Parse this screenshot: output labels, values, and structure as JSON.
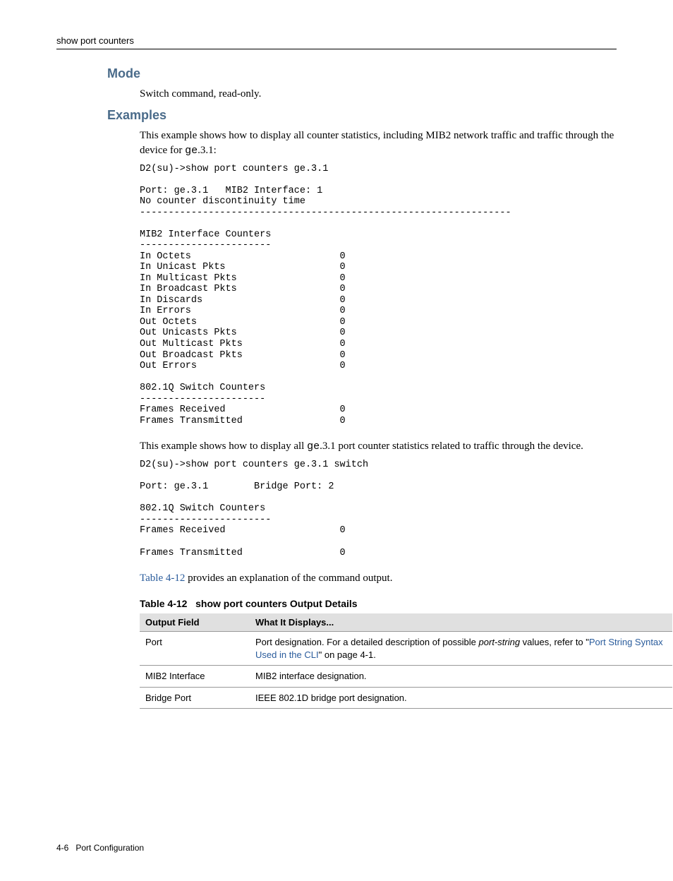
{
  "header": {
    "title": "show port counters"
  },
  "sections": {
    "mode": {
      "heading": "Mode",
      "text": "Switch command, read-only."
    },
    "examples": {
      "heading": "Examples",
      "intro1a": "This example shows how to display all counter statistics, including MIB2 network traffic and traffic through the device for ",
      "intro1_code": "ge",
      "intro1b": ".3.1:",
      "code1": {
        "cmd": "D2(su)->show port counters ge.3.1",
        "port_line": "Port: ge.3.1   MIB2 Interface: 1",
        "nodisc": "No counter discontinuity time",
        "rule": "-----------------------------------------------------------------",
        "sect1_title": "MIB2 Interface Counters",
        "sect1_rule": "-----------------------",
        "counters1": [
          [
            "In Octets",
            "0"
          ],
          [
            "In Unicast Pkts",
            "0"
          ],
          [
            "In Multicast Pkts",
            "0"
          ],
          [
            "In Broadcast Pkts",
            "0"
          ],
          [
            "In Discards",
            "0"
          ],
          [
            "In Errors",
            "0"
          ],
          [
            "Out Octets",
            "0"
          ],
          [
            "Out Unicasts Pkts",
            "0"
          ],
          [
            "Out Multicast Pkts",
            "0"
          ],
          [
            "Out Broadcast Pkts",
            "0"
          ],
          [
            "Out Errors",
            "0"
          ]
        ],
        "sect2_title": "802.1Q Switch Counters",
        "sect2_rule": "----------------------",
        "counters2": [
          [
            "Frames Received",
            "0"
          ],
          [
            "Frames Transmitted",
            "0"
          ]
        ]
      },
      "intro2a": "This example shows how to display all ",
      "intro2_code": "ge",
      "intro2b": ".3.1 port counter statistics related to traffic through the device.",
      "code2": {
        "cmd": "D2(su)->show port counters ge.3.1 switch",
        "port_line": "Port: ge.3.1        Bridge Port: 2",
        "sect_title": "802.1Q Switch Counters",
        "sect_rule": "-----------------------",
        "counters": [
          [
            "Frames Received",
            "0"
          ],
          [
            "Frames Transmitted",
            "0"
          ]
        ]
      },
      "table_ref_link": "Table 4-12",
      "table_ref_rest": " provides an explanation of the command output."
    }
  },
  "table": {
    "caption_a": "Table 4-12",
    "caption_b": "show port counters Output Details",
    "head_field": "Output Field",
    "head_desc": "What It Displays...",
    "rows": [
      {
        "field": "Port",
        "desc_a": "Port designation. For a detailed description of possible ",
        "desc_i": "port-string",
        "desc_b": " values, refer to \"",
        "desc_link": "Port String Syntax Used in the CLI",
        "desc_c": "\" on page 4-1."
      },
      {
        "field": "MIB2 Interface",
        "desc_plain": "MIB2 interface designation."
      },
      {
        "field": "Bridge Port",
        "desc_plain": "IEEE 802.1D bridge port designation."
      }
    ]
  },
  "footer": {
    "page": "4-6",
    "chapter": "Port Configuration"
  }
}
